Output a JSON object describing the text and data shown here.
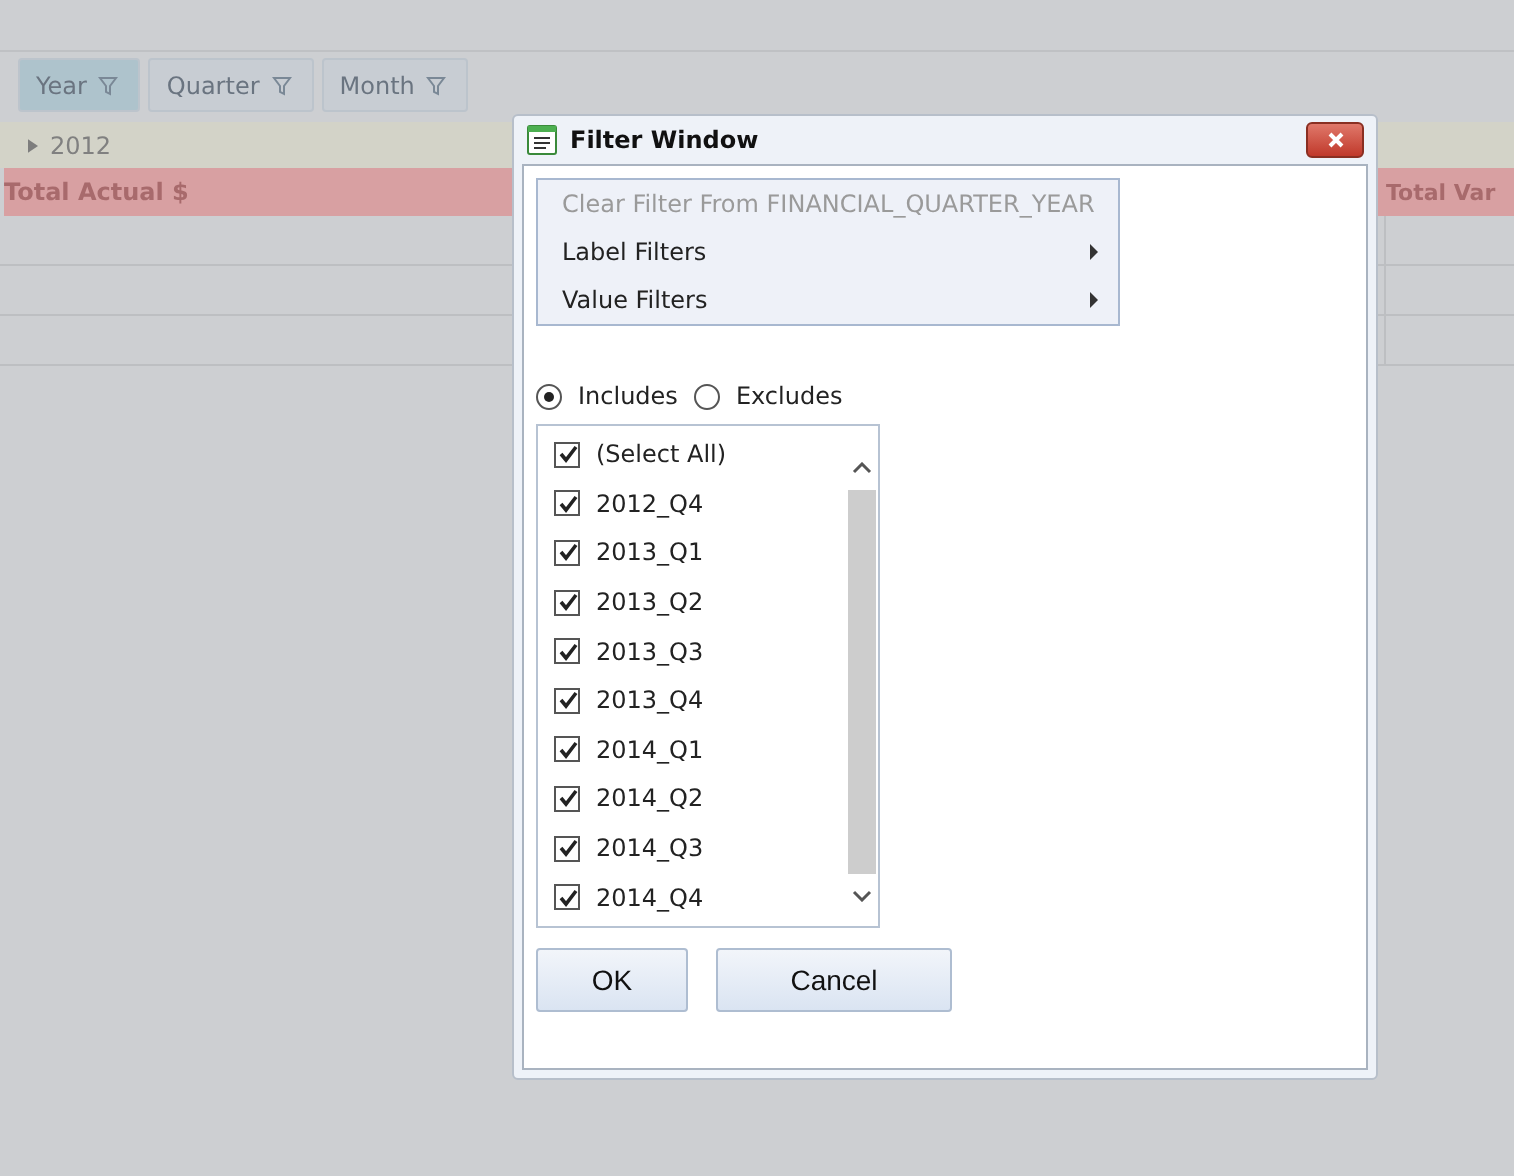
{
  "pivot": {
    "fields": [
      {
        "label": "Year",
        "selected": true
      },
      {
        "label": "Quarter",
        "selected": false
      },
      {
        "label": "Month",
        "selected": false
      }
    ],
    "row_header": "2012",
    "columns": [
      "Total Actual $",
      "Total Var"
    ]
  },
  "dialog": {
    "title": "Filter Window",
    "menu": [
      {
        "label": "Clear Filter From FINANCIAL_QUARTER_YEAR",
        "disabled": true,
        "submenu": false
      },
      {
        "label": "Label Filters",
        "disabled": false,
        "submenu": true
      },
      {
        "label": "Value Filters",
        "disabled": false,
        "submenu": true
      }
    ],
    "mode": [
      {
        "label": "Includes",
        "selected": true
      },
      {
        "label": "Excludes",
        "selected": false
      }
    ],
    "items": [
      {
        "label": "(Select All)",
        "checked": true
      },
      {
        "label": "2012_Q4",
        "checked": true
      },
      {
        "label": "2013_Q1",
        "checked": true
      },
      {
        "label": "2013_Q2",
        "checked": true
      },
      {
        "label": "2013_Q3",
        "checked": true
      },
      {
        "label": "2013_Q4",
        "checked": true
      },
      {
        "label": "2014_Q1",
        "checked": true
      },
      {
        "label": "2014_Q2",
        "checked": true
      },
      {
        "label": "2014_Q3",
        "checked": true
      },
      {
        "label": "2014_Q4",
        "checked": true
      }
    ],
    "buttons": [
      "OK",
      "Cancel"
    ]
  }
}
